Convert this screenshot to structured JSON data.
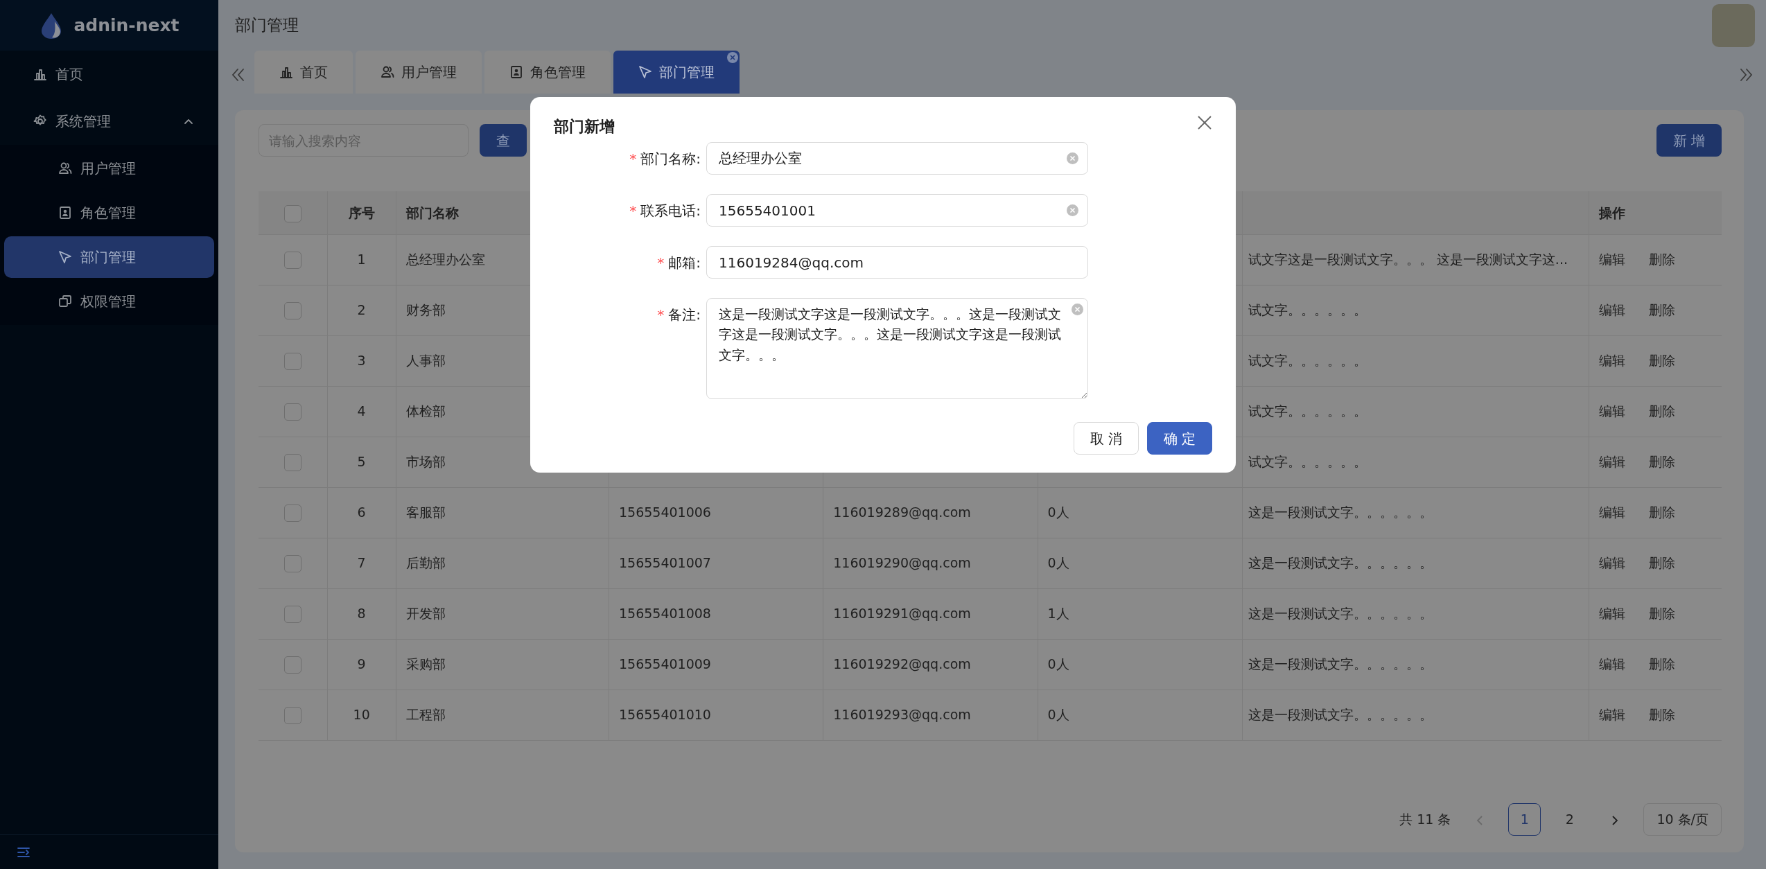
{
  "sidebar": {
    "logo": "adnin-next",
    "items": [
      {
        "label": "首页",
        "selected": false
      },
      {
        "label": "系统管理",
        "selected": false,
        "expanded": true,
        "children": [
          {
            "label": "用户管理",
            "selected": false
          },
          {
            "label": "角色管理",
            "selected": false
          },
          {
            "label": "部门管理",
            "selected": true
          },
          {
            "label": "权限管理",
            "selected": false
          }
        ]
      }
    ]
  },
  "header": {
    "title": "部门管理"
  },
  "tabs": [
    {
      "label": "首页",
      "selected": false
    },
    {
      "label": "用户管理",
      "selected": false
    },
    {
      "label": "角色管理",
      "selected": false
    },
    {
      "label": "部门管理",
      "selected": true
    }
  ],
  "toolbar": {
    "search": {
      "placeholder": "请输入搜索内容"
    },
    "query_button": "查",
    "add_button": "新 增"
  },
  "table": {
    "header_checked": false,
    "columns": [
      "序号",
      "部门名称",
      "操作"
    ],
    "rows": [
      {
        "checked": false,
        "index": "1",
        "name": "总经理办公室",
        "notes": "试文字这是一段测试文字。。。 这是一段测试文字这...",
        "actions": [
          "编辑",
          "删除"
        ]
      },
      {
        "checked": false,
        "index": "2",
        "name": "财务部",
        "notes": "试文字。。。。。。",
        "actions": [
          "编辑",
          "删除"
        ]
      },
      {
        "checked": false,
        "index": "3",
        "name": "人事部",
        "notes": "试文字。。。。。。",
        "actions": [
          "编辑",
          "删除"
        ]
      },
      {
        "checked": false,
        "index": "4",
        "name": "体检部",
        "notes": "试文字。。。。。。",
        "actions": [
          "编辑",
          "删除"
        ]
      },
      {
        "checked": false,
        "index": "5",
        "name": "市场部",
        "notes": "试文字。。。。。。",
        "actions": [
          "编辑",
          "删除"
        ]
      },
      {
        "checked": false,
        "index": "6",
        "name": "客服部",
        "phone": "15655401006",
        "email": "116019289@qq.com",
        "count": "0人",
        "notes": "这是一段测试文字。。。。。。",
        "actions": [
          "编辑",
          "删除"
        ]
      },
      {
        "checked": false,
        "index": "7",
        "name": "后勤部",
        "phone": "15655401007",
        "email": "116019290@qq.com",
        "count": "0人",
        "notes": "这是一段测试文字。。。。。。",
        "actions": [
          "编辑",
          "删除"
        ]
      },
      {
        "checked": false,
        "index": "8",
        "name": "开发部",
        "phone": "15655401008",
        "email": "116019291@qq.com",
        "count": "1人",
        "notes": "这是一段测试文字。。。。。。",
        "actions": [
          "编辑",
          "删除"
        ]
      },
      {
        "checked": false,
        "index": "9",
        "name": "采购部",
        "phone": "15655401009",
        "email": "116019292@qq.com",
        "count": "0人",
        "notes": "这是一段测试文字。。。。。。",
        "actions": [
          "编辑",
          "删除"
        ]
      },
      {
        "checked": false,
        "index": "10",
        "name": "工程部",
        "phone": "15655401010",
        "email": "116019293@qq.com",
        "count": "0人",
        "notes": "这是一段测试文字。。。。。。",
        "actions": [
          "编辑",
          "删除"
        ]
      }
    ]
  },
  "pagination": {
    "total": "共 11 条",
    "prev_disabled": true,
    "next_disabled": false,
    "pages": [
      {
        "label": "1",
        "selected": true
      },
      {
        "label": "2",
        "selected": false
      }
    ],
    "page_size": "10 条/页"
  },
  "dialog": {
    "title": "部门新增",
    "required_mark": "*",
    "fields": [
      {
        "kind": "input",
        "label": "部门名称:",
        "required": true,
        "value": "总经理办公室",
        "clearable": true
      },
      {
        "kind": "input",
        "label": "联系电话:",
        "required": true,
        "value": "15655401001",
        "clearable": true
      },
      {
        "kind": "input",
        "label": "邮箱:",
        "required": true,
        "value": "116019284@qq.com",
        "clearable": false
      },
      {
        "kind": "textarea",
        "label": "备注:",
        "required": true,
        "value": "这是一段测试文字这是一段测试文字。。。这是一段测试文字这是一段测试文字。。。这是一段测试文字这是一段测试文字。。。",
        "clearable": true
      }
    ],
    "buttons": [
      {
        "label": "取 消",
        "kind": "default"
      },
      {
        "label": "确 定",
        "kind": "primary"
      }
    ]
  }
}
